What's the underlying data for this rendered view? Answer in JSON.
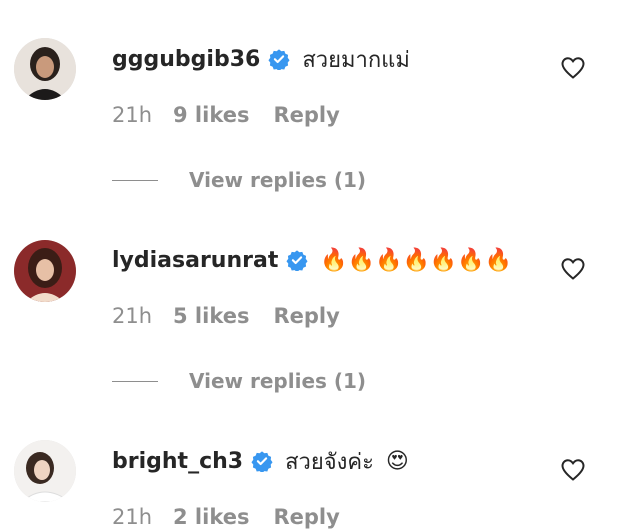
{
  "comments": [
    {
      "username": "gggubgib36",
      "text": "สวยมากแม่",
      "time": "21h",
      "likes": "9 likes",
      "reply": "Reply",
      "view_replies": "View replies (1)",
      "icon": "verified-badge-icon"
    },
    {
      "username": "lydiasarunrat",
      "text": "🔥🔥🔥🔥🔥🔥🔥",
      "time": "21h",
      "likes": "5 likes",
      "reply": "Reply",
      "view_replies": "View replies (1)",
      "icon": "verified-badge-icon"
    },
    {
      "username": "bright_ch3",
      "text": "สวยจังค่ะ",
      "emoji": "😍",
      "time": "21h",
      "likes": "2 likes",
      "reply": "Reply",
      "icon": "verified-badge-icon"
    }
  ],
  "colors": {
    "verified": "#3897f0",
    "muted": "#8e8e8e",
    "text": "#262626"
  }
}
